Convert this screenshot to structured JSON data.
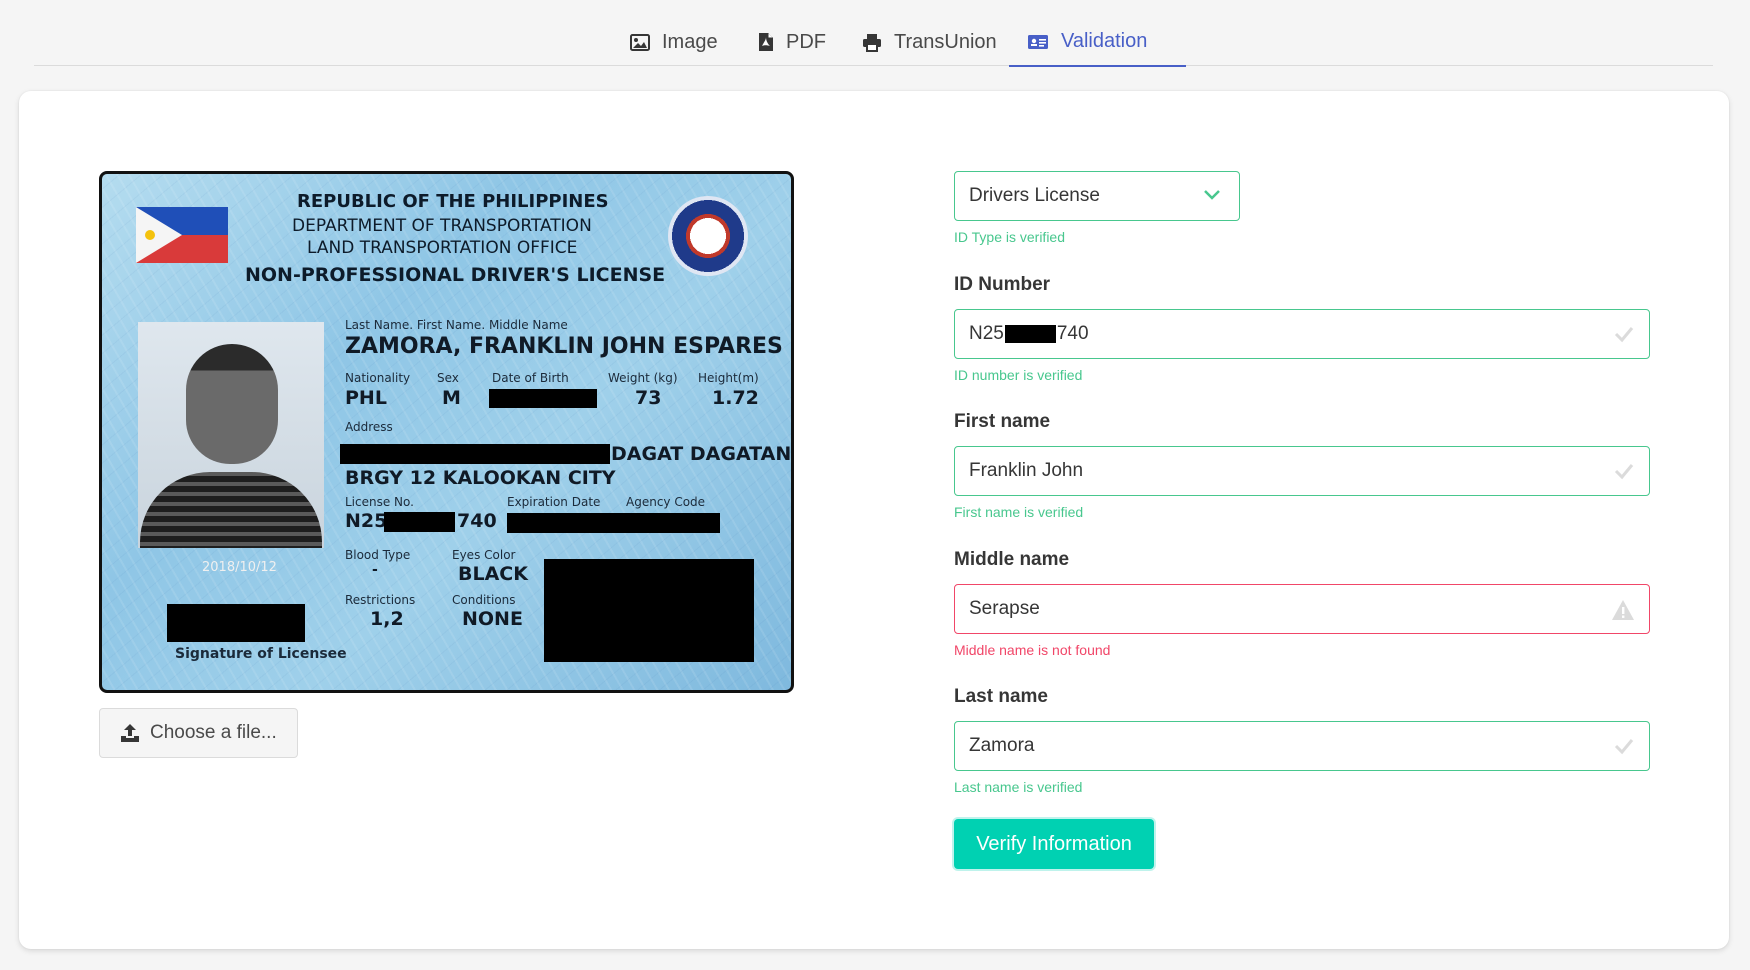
{
  "tabs": [
    {
      "label": "Image",
      "icon": "image-icon"
    },
    {
      "label": "PDF",
      "icon": "pdf-icon"
    },
    {
      "label": "TransUnion",
      "icon": "printer-icon"
    },
    {
      "label": "Validation",
      "icon": "id-card-icon",
      "active": true
    }
  ],
  "id_card": {
    "header1": "REPUBLIC OF THE PHILIPPINES",
    "header2": "DEPARTMENT OF TRANSPORTATION",
    "header3": "LAND TRANSPORTATION OFFICE",
    "header4": "NON-PROFESSIONAL DRIVER'S LICENSE",
    "name_label": "Last Name. First Name. Middle Name",
    "name_value": "ZAMORA, FRANKLIN JOHN ESPARES",
    "nationality_label": "Nationality",
    "nationality": "PHL",
    "sex_label": "Sex",
    "sex": "M",
    "dob_label": "Date of Birth",
    "weight_label": "Weight (kg)",
    "weight": "73",
    "height_label": "Height(m)",
    "height": "1.72",
    "address_label": "Address",
    "address_line1": "DAGAT DAGATAN",
    "address_line2": "BRGY 12 KALOOKAN CITY",
    "license_label": "License No.",
    "license_prefix": "N25",
    "license_suffix": "740",
    "expiration_label": "Expiration Date",
    "agency_label": "Agency Code",
    "blood_label": "Blood Type",
    "blood": "-",
    "eyes_label": "Eyes Color",
    "eyes": "BLACK",
    "restrictions_label": "Restrictions",
    "restrictions": "1,2",
    "conditions_label": "Conditions",
    "conditions": "NONE",
    "photo_date": "2018/10/12",
    "signature_label": "Signature of Licensee"
  },
  "upload": {
    "label": "Choose a file..."
  },
  "form": {
    "id_type": {
      "value": "Drivers License",
      "help": "ID Type is verified"
    },
    "id_number": {
      "label": "ID Number",
      "prefix": "N25",
      "suffix": "740",
      "help": "ID number is verified"
    },
    "first_name": {
      "label": "First name",
      "value": "Franklin John",
      "help": "First name is verified"
    },
    "middle_name": {
      "label": "Middle name",
      "value": "Serapse",
      "help": "Middle name is not found"
    },
    "last_name": {
      "label": "Last name",
      "value": "Zamora",
      "help": "Last name is verified"
    },
    "submit": "Verify Information"
  },
  "colors": {
    "success": "#48c78e",
    "danger": "#f14668",
    "primary": "#00d1b2",
    "link": "#485fc7"
  }
}
